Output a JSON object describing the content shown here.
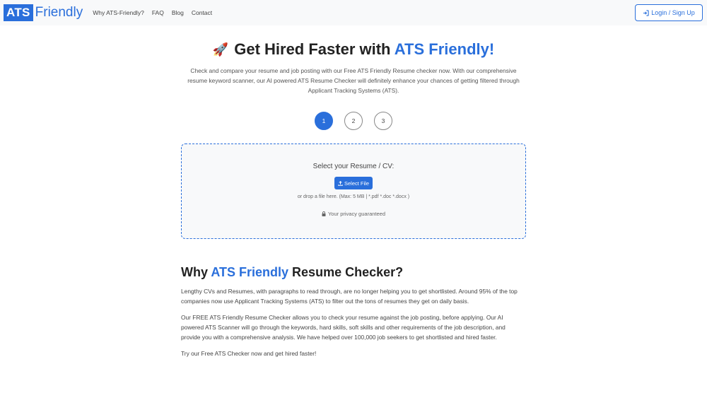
{
  "brand": {
    "part1": "ATS",
    "part2": "Friendly",
    "accent_color": "#2a6fdb"
  },
  "nav": {
    "links": [
      "Why ATS-Friendly?",
      "FAQ",
      "Blog",
      "Contact"
    ],
    "login_label": "Login / Sign Up"
  },
  "hero": {
    "emoji": "🚀",
    "title_prefix": "Get Hired Faster with",
    "title_accent": "ATS Friendly!",
    "description": "Check and compare your resume and job posting with our Free ATS Friendly Resume checker now. With our comprehensive resume keyword scanner, our AI powered ATS Resume Checker will definitely enhance your chances of getting filtered through Applicant Tracking Systems (ATS)."
  },
  "steps": [
    "1",
    "2",
    "3"
  ],
  "upload": {
    "label": "Select your Resume / CV:",
    "button": "Select File",
    "hint": "or drop a file here. (Max: 5 MB | *.pdf *.doc *.docx )",
    "privacy": "Your privacy guaranteed"
  },
  "why": {
    "title_prefix": "Why",
    "title_accent": "ATS Friendly",
    "title_suffix": "Resume Checker?",
    "paragraphs": [
      "Lengthy CVs and Resumes, with paragraphs to read through, are no longer helping you to get shortlisted. Around 95% of the top companies now use Applicant Tracking Systems (ATS) to filter out the tons of resumes they get on daily basis.",
      "Our FREE ATS Friendly Resume Checker allows you to check your resume against the job posting, before applying. Our AI powered ATS Scanner will go through the keywords, hard skills, soft skills and other requirements of the job description, and provide you with a comprehensive analysis. We have helped over 100,000 job seekers to get shortlisted and hired faster.",
      "Try our Free ATS Checker now and get hired faster!"
    ]
  }
}
